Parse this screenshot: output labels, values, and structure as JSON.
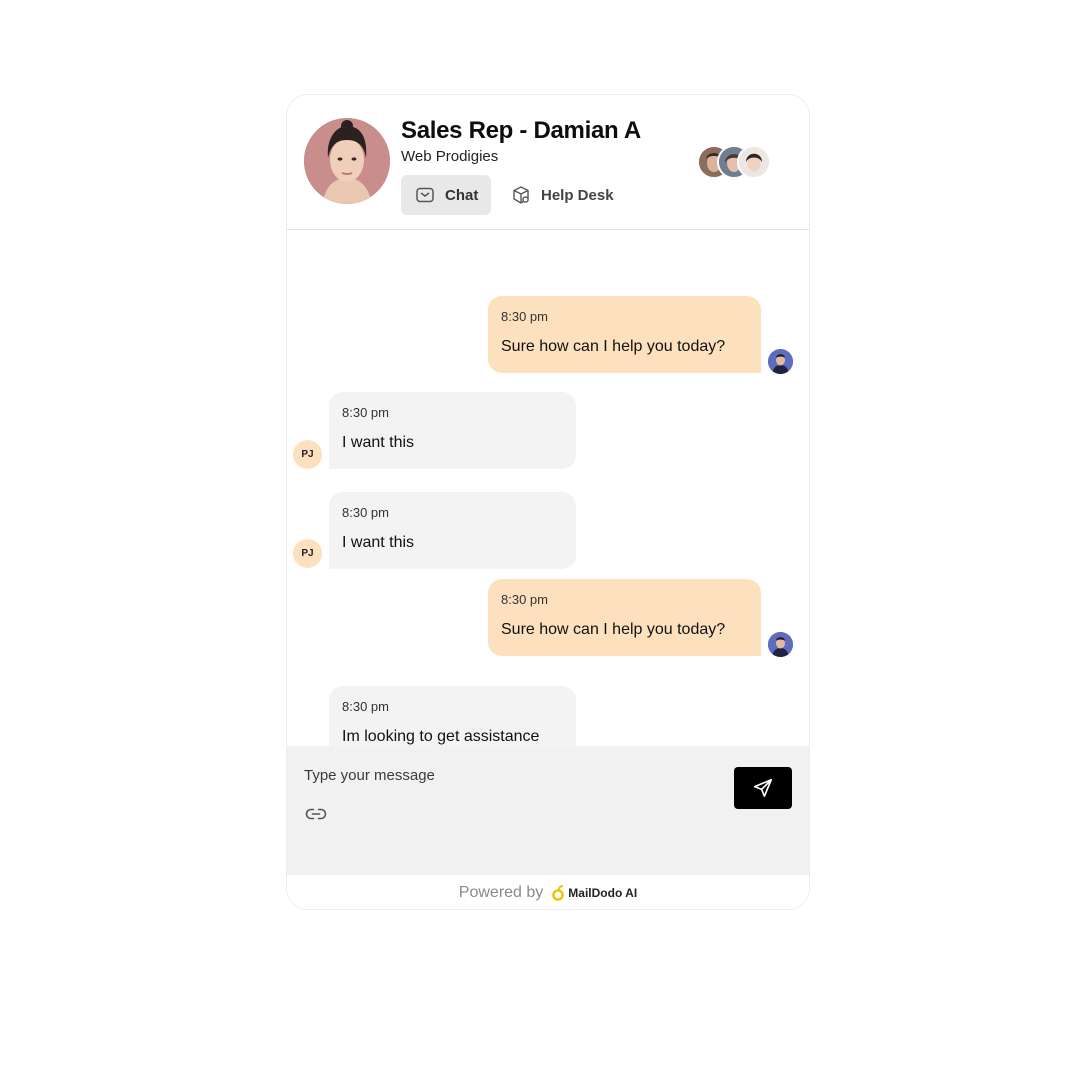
{
  "header": {
    "title": "Sales Rep - Damian A",
    "subtitle": "Web Prodigies",
    "tabs": [
      {
        "label": "Chat",
        "icon": "mail-icon",
        "active": true
      },
      {
        "label": "Help Desk",
        "icon": "box-icon",
        "active": false
      }
    ]
  },
  "messages": [
    {
      "direction": "outgoing",
      "time": "8:30 pm",
      "text": "Sure how can I help you today?"
    },
    {
      "direction": "incoming",
      "sender_initials": "PJ",
      "time": "8:30 pm",
      "text": "I want this"
    },
    {
      "direction": "incoming",
      "sender_initials": "PJ",
      "time": "8:30 pm",
      "text": "I want this"
    },
    {
      "direction": "outgoing",
      "time": "8:30 pm",
      "text": "Sure how can I help you today?"
    },
    {
      "direction": "incoming",
      "time": "8:30 pm",
      "text": "Im looking to get assistance"
    }
  ],
  "composer": {
    "placeholder": "Type your message",
    "value": ""
  },
  "footer": {
    "powered_by": "Powered by",
    "brand": "MailDodo AI"
  },
  "colors": {
    "outgoing_bubble": "#fde0bd",
    "incoming_bubble": "#f3f3f3",
    "send_button": "#000000",
    "composer_bg": "#f1f1f1"
  }
}
